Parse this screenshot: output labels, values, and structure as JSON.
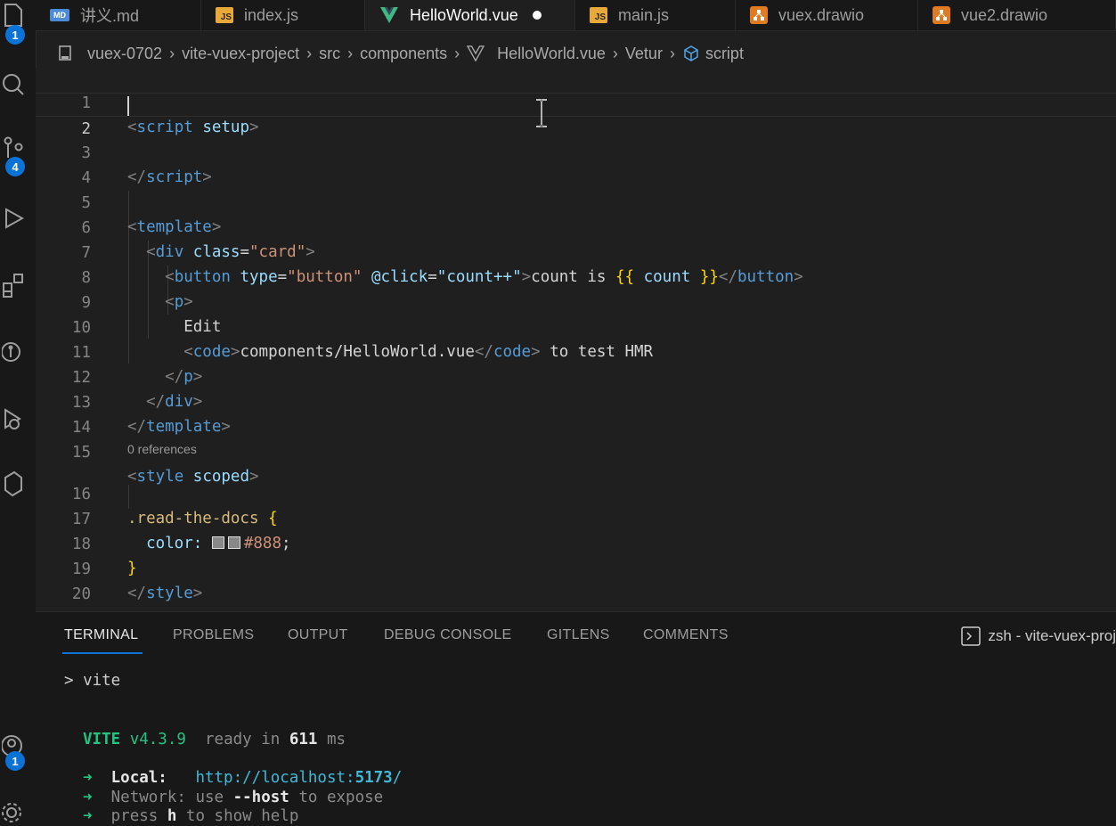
{
  "tabs": [
    {
      "label": "讲义.md",
      "icon": "markdown-icon",
      "icon_text": "MD"
    },
    {
      "label": "index.js",
      "icon": "javascript-icon",
      "icon_text": "JS"
    },
    {
      "label": "HelloWorld.vue",
      "icon": "vue-icon",
      "active": true,
      "modified": true
    },
    {
      "label": "main.js",
      "icon": "javascript-icon",
      "icon_text": "JS"
    },
    {
      "label": "vuex.drawio",
      "icon": "drawio-icon"
    },
    {
      "label": "vue2.drawio",
      "icon": "drawio-icon"
    }
  ],
  "activity_badges": {
    "explorer": "1",
    "source_control": "4",
    "accounts": "1"
  },
  "breadcrumb": [
    "vuex-0702",
    "vite-vuex-project",
    "src",
    "components",
    "HelloWorld.vue",
    "Vetur",
    "script"
  ],
  "editor": {
    "line_numbers": [
      "1",
      "2",
      "3",
      "4",
      "5",
      "6",
      "7",
      "8",
      "9",
      "10",
      "11",
      "12",
      "13",
      "14",
      "15",
      "16",
      "17",
      "18",
      "19",
      "20"
    ],
    "codelens": "0 references",
    "tokens": {
      "lt": "<",
      "gt": ">",
      "lt_slash": "</",
      "script": "script",
      "setup": "setup",
      "template": "template",
      "div": "div",
      "class_attr": "class",
      "eq": "=",
      "card_str": "\"card\"",
      "button": "button",
      "type_attr": "type",
      "button_str": "\"button\"",
      "click_attr": "@click",
      "count_str": "\"count++\"",
      "count_is": "count is ",
      "mustache_open": "{{",
      "count_var": " count ",
      "mustache_close": "}}",
      "p": "p",
      "edit": "Edit",
      "code": "code",
      "code_text": "components/HelloWorld.vue",
      "to_test": " to test HMR",
      "style": "style",
      "scoped": "scoped",
      "selector": ".read-the-docs",
      "brace_open": " {",
      "brace_close": "}",
      "color_prop": "color: ",
      "color_val": "#888",
      "semicolon": ";"
    }
  },
  "panel": {
    "tabs": [
      "TERMINAL",
      "PROBLEMS",
      "OUTPUT",
      "DEBUG CONSOLE",
      "GITLENS",
      "COMMENTS"
    ],
    "terminal_label": "zsh - vite-vuex-proj",
    "terminal": {
      "cmd": "> vite",
      "vite": "VITE",
      "version": " v4.3.9",
      "ready": "  ready in ",
      "ms_value": "611",
      "ms_unit": " ms",
      "arrow": "➜",
      "local_label": "Local:",
      "local_url_prefix": "http://localhost:",
      "local_port": "5173",
      "local_url_suffix": "/",
      "network_label": "Network:",
      "network_use": " use ",
      "network_host": "--host",
      "network_expose": " to expose",
      "press": "press ",
      "h": "h",
      "show_help": " to show help"
    }
  },
  "colors": {
    "accent": "#0b72d6",
    "background": "#1f1f1f",
    "vite_green": "#23c483"
  }
}
